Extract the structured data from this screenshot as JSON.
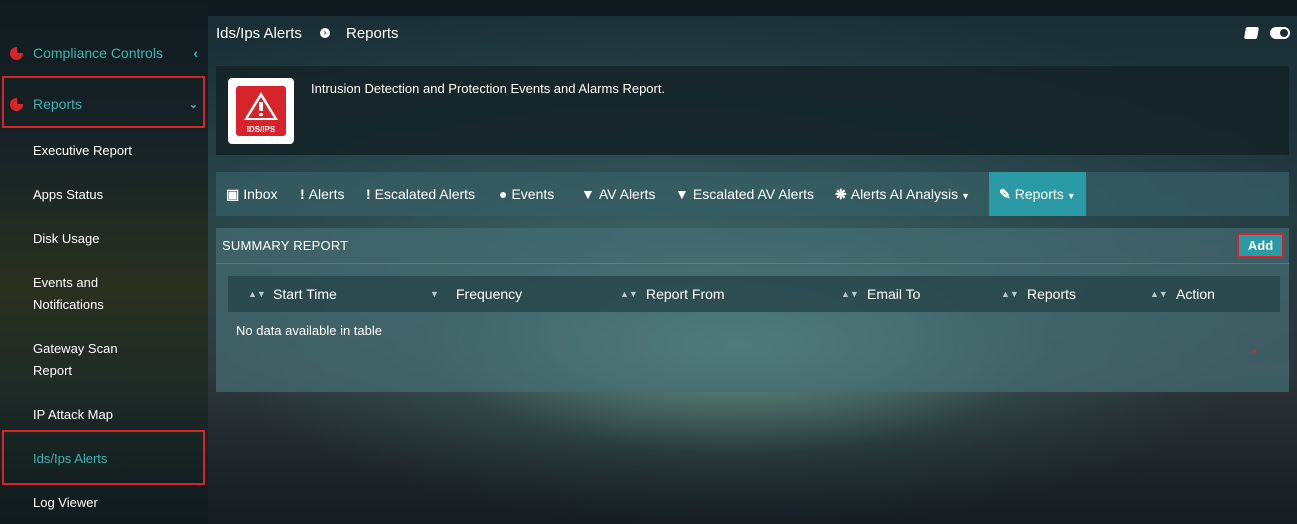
{
  "sidebar": {
    "compliance_label": "Compliance Controls",
    "reports_label": "Reports",
    "items": [
      "Executive Report",
      "Apps Status",
      "Disk Usage",
      "Events and Notifications",
      "Gateway Scan Report",
      "IP Attack Map",
      "Ids/Ips Alerts",
      "Log Viewer"
    ],
    "accent_color": "#3fb3b3",
    "highlight_color": "#d6242a"
  },
  "breadcrumb": {
    "root": "Ids/Ips Alerts",
    "current": "Reports"
  },
  "header": {
    "logo_text": "IDS/IPS",
    "description": "Intrusion Detection and Protection Events and Alarms Report."
  },
  "tabs": [
    {
      "label": "Inbox",
      "icon": "inbox-icon"
    },
    {
      "label": "Alerts",
      "icon": "exclamation-icon"
    },
    {
      "label": "Escalated Alerts",
      "icon": "exclamation-icon"
    },
    {
      "label": "Events",
      "icon": "exclamation-circle-icon"
    },
    {
      "label": "AV Alerts",
      "icon": "shield-icon"
    },
    {
      "label": "Escalated AV Alerts",
      "icon": "shield-icon"
    },
    {
      "label": "Alerts AI Analysis",
      "icon": "ai-icon"
    },
    {
      "label": "Reports",
      "icon": "pencil-icon"
    }
  ],
  "summary": {
    "title": "SUMMARY REPORT",
    "add_label": "Add",
    "columns": [
      "Start Time",
      "Frequency",
      "Report From",
      "Email To",
      "Reports",
      "Action"
    ],
    "empty_message": "No data available in table"
  }
}
